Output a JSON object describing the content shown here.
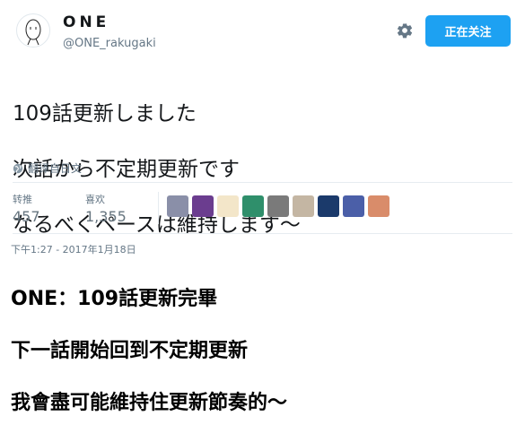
{
  "profile": {
    "display_name": "ONE",
    "handle": "@ONE_rakugaki"
  },
  "header": {
    "follow_button_label": "正在关注",
    "settings_icon": "gear-icon"
  },
  "tweet": {
    "lines": [
      "109話更新しました",
      "次話から不定期更新です",
      "なるべくペースは維持します～"
    ],
    "translate_label": "翻译自日文",
    "timestamp": "下午1:27 - 2017年1月18日"
  },
  "stats": {
    "retweets_label": "转推",
    "retweets_value": "457",
    "likes_label": "喜欢",
    "likes_value": "1,355"
  },
  "likers": [
    {
      "color": "#8a8fa8"
    },
    {
      "color": "#6b3d8f"
    },
    {
      "color": "#f3e6c9"
    },
    {
      "color": "#2f8f6b"
    },
    {
      "color": "#7a7a7a"
    },
    {
      "color": "#c4b6a3"
    },
    {
      "color": "#1b3a6b"
    },
    {
      "color": "#4b5fa8"
    },
    {
      "color": "#d98c6a"
    }
  ],
  "overlay_translation": {
    "lines": [
      "ONE：109話更新完畢",
      "下一話開始回到不定期更新",
      "我會盡可能維持住更新節奏的～"
    ]
  }
}
